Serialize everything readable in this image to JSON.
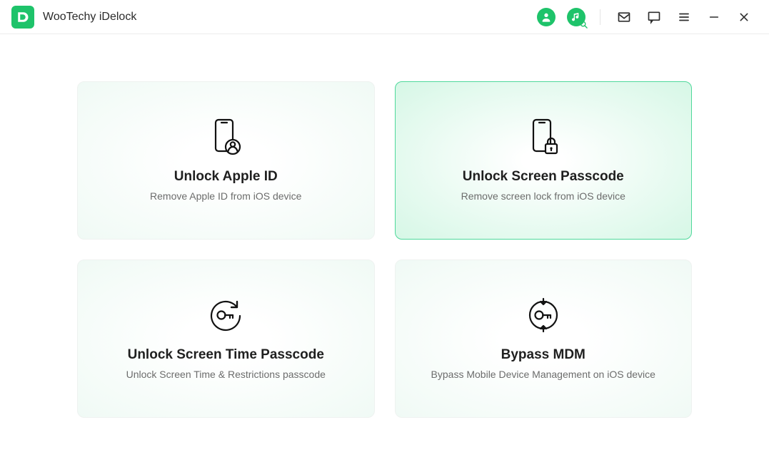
{
  "app": {
    "title": "WooTechy iDelock"
  },
  "cards": [
    {
      "title": "Unlock Apple ID",
      "desc": "Remove Apple ID from iOS device",
      "highlight": false
    },
    {
      "title": "Unlock Screen Passcode",
      "desc": "Remove screen lock from iOS device",
      "highlight": true
    },
    {
      "title": "Unlock Screen Time Passcode",
      "desc": "Unlock Screen Time & Restrictions passcode",
      "highlight": false
    },
    {
      "title": "Bypass MDM",
      "desc": "Bypass Mobile Device Management on iOS device",
      "highlight": false
    }
  ]
}
